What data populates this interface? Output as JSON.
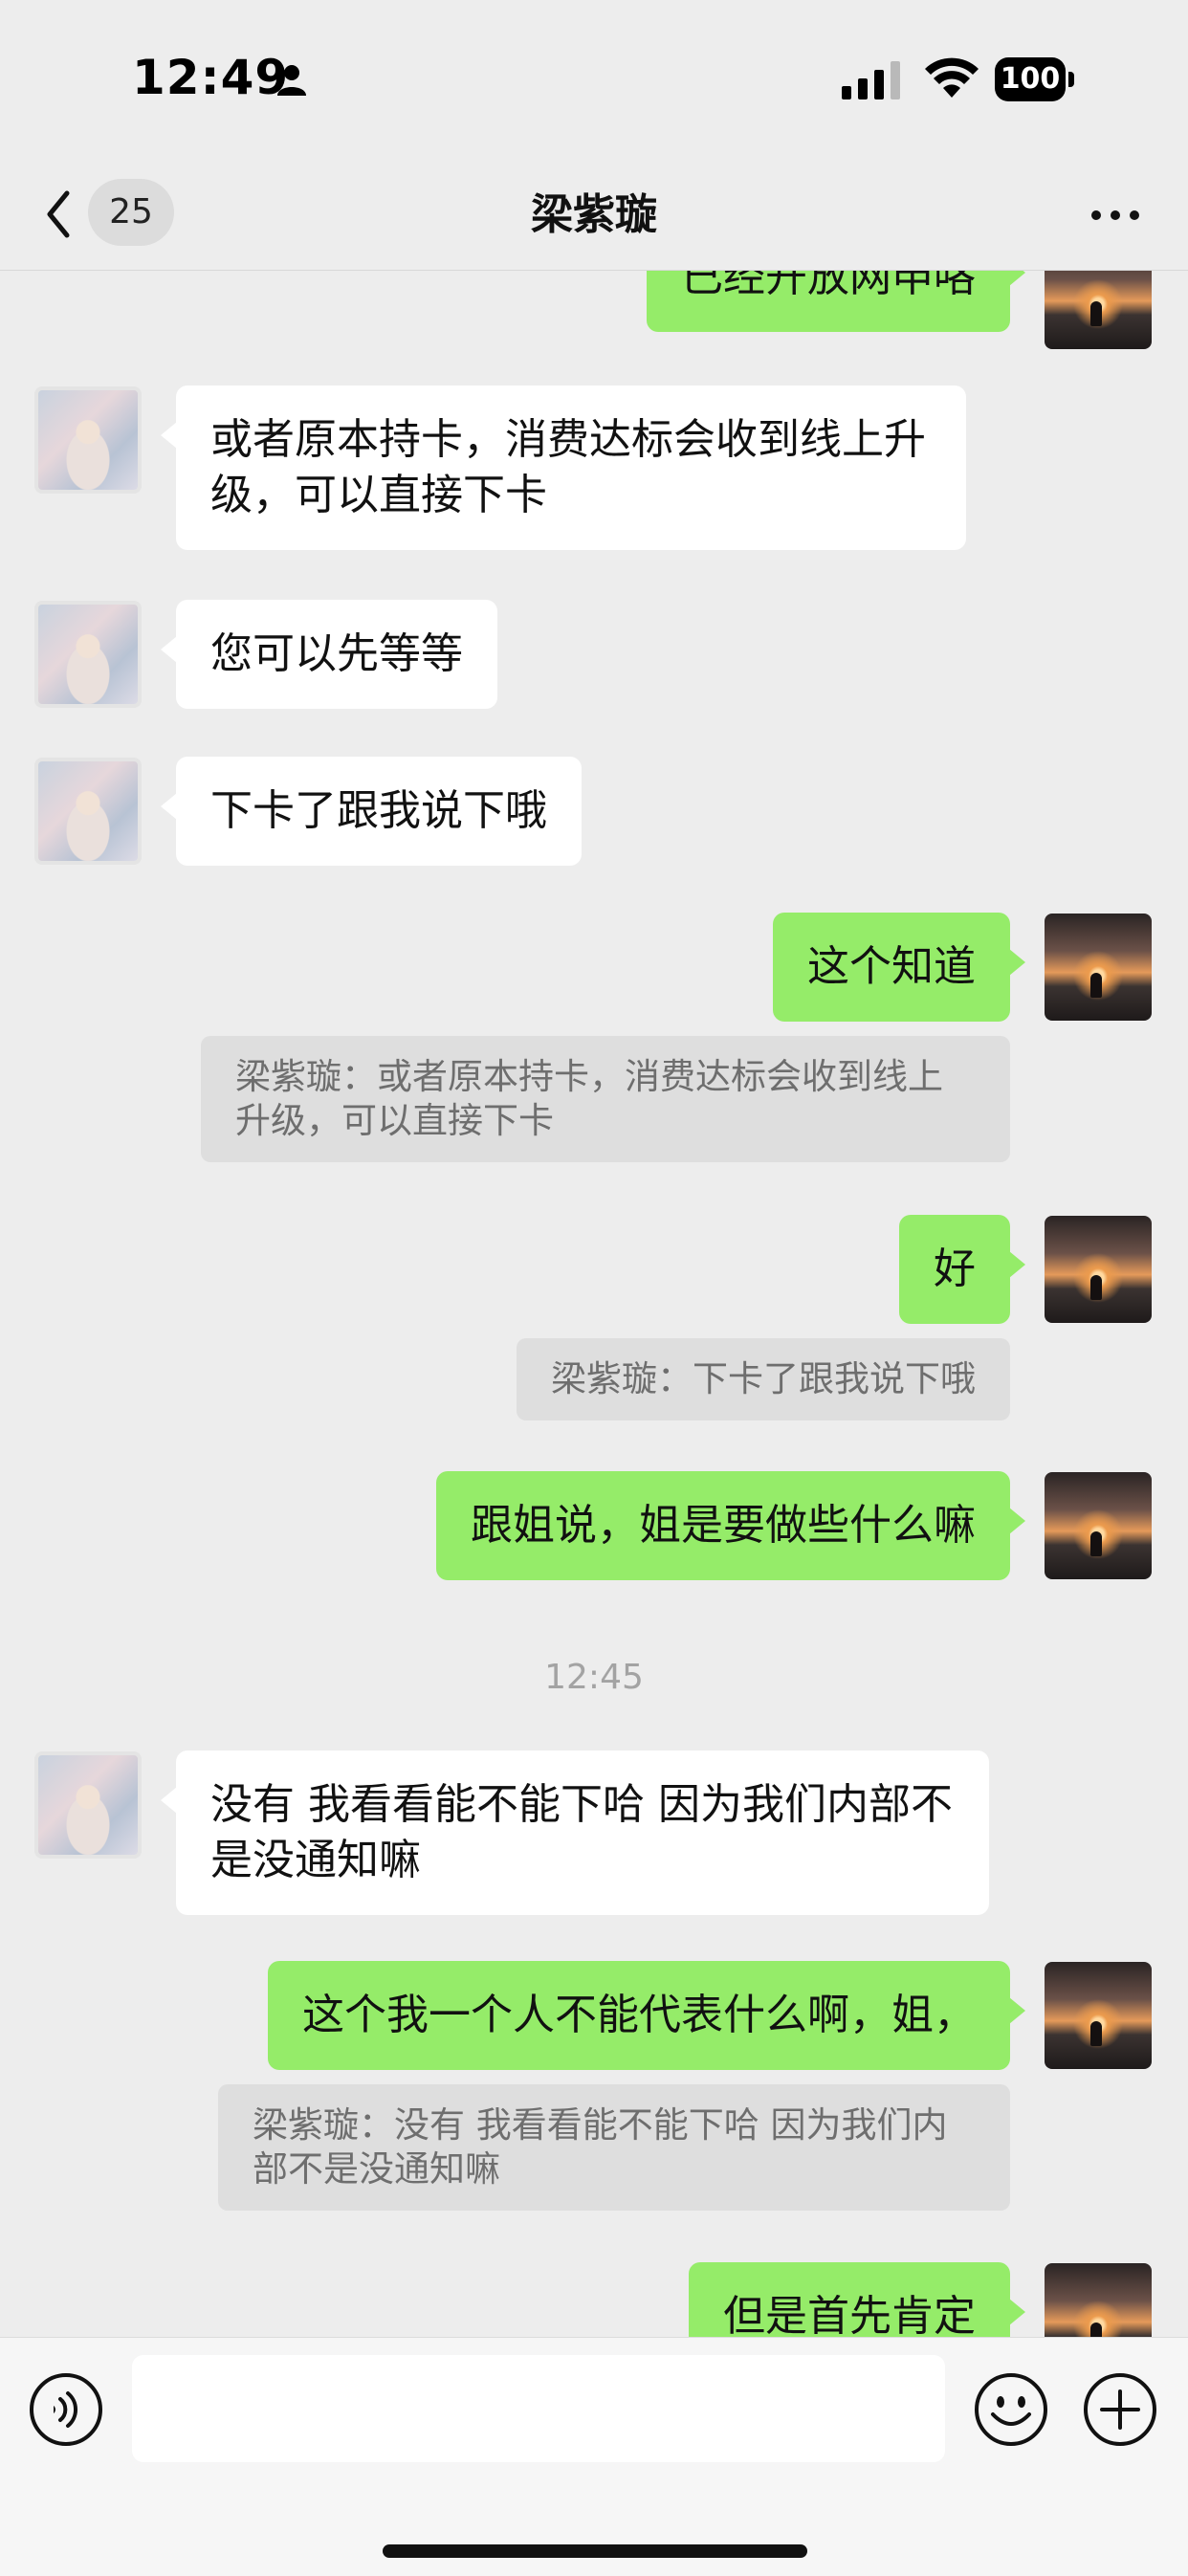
{
  "status_bar": {
    "time": "12:49",
    "battery": "100"
  },
  "nav": {
    "unread_count": "25",
    "title": "梁紫璇"
  },
  "messages": [
    {
      "side": "out",
      "text": "已经开放网申咯"
    },
    {
      "side": "in",
      "text": "或者原本持卡，消费达标会收到线上升级，可以直接下卡"
    },
    {
      "side": "in",
      "text": "您可以先等等"
    },
    {
      "side": "in",
      "text": "下卡了跟我说下哦"
    },
    {
      "side": "out",
      "text": "这个知道",
      "quote": "梁紫璇：或者原本持卡，消费达标会收到线上升级，可以直接下卡"
    },
    {
      "side": "out",
      "text": "好",
      "quote": "梁紫璇：下卡了跟我说下哦"
    },
    {
      "side": "out",
      "text": "跟姐说，姐是要做些什么嘛"
    },
    {
      "type": "timestamp",
      "text": "12:45"
    },
    {
      "side": "in",
      "text": "没有 我看看能不能下哈 因为我们内部不是没通知嘛"
    },
    {
      "side": "out",
      "text": "这个我一个人不能代表什么啊，姐，",
      "quote": "梁紫璇：没有 我看看能不能下哈 因为我们内部不是没通知嘛"
    },
    {
      "side": "out",
      "text": "但是首先肯定"
    }
  ],
  "input": {
    "value": "",
    "placeholder": ""
  },
  "colors": {
    "background": "#ededed",
    "outgoing_bubble": "#95ec69",
    "incoming_bubble": "#ffffff"
  },
  "icons": [
    "person-icon",
    "signal-icon",
    "wifi-icon",
    "back-arrow-icon",
    "more-icon",
    "voice-icon",
    "emoji-icon",
    "plus-icon"
  ]
}
